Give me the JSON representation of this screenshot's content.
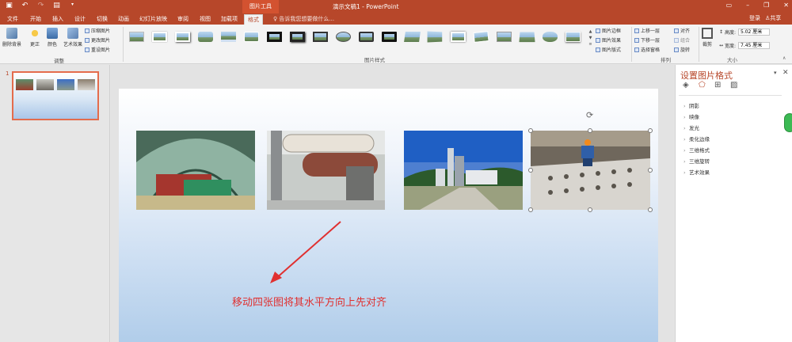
{
  "titlebar": {
    "context_tools": "图片工具",
    "doc_title": "演示文稿1 - PowerPoint"
  },
  "tabs": [
    {
      "label": "文件"
    },
    {
      "label": "开始"
    },
    {
      "label": "插入"
    },
    {
      "label": "设计"
    },
    {
      "label": "切换"
    },
    {
      "label": "动画"
    },
    {
      "label": "幻灯片放映"
    },
    {
      "label": "审阅"
    },
    {
      "label": "视图"
    },
    {
      "label": "加载项"
    },
    {
      "label": "格式"
    }
  ],
  "tell_me": "告诉我您想要做什么...",
  "account": {
    "login": "登录",
    "share": "共享"
  },
  "ribbon": {
    "adjust": {
      "remove_bg": "删除背景",
      "corrections": "更正",
      "color": "颜色",
      "artistic": "艺术效果",
      "compress": "压缩图片",
      "change": "更改图片",
      "reset": "重设图片",
      "group_label": "调整"
    },
    "styles": {
      "group_label": "图片样式",
      "border": "图片边框",
      "effects": "图片效果",
      "layout": "图片版式"
    },
    "arrange": {
      "forward": "上移一层",
      "backward": "下移一层",
      "selection": "选择窗格",
      "align": "对齐",
      "group": "组合",
      "rotate": "旋转",
      "group_label": "排列"
    },
    "size": {
      "crop": "裁剪",
      "height_label": "高度:",
      "height_value": "5.02 厘米",
      "width_label": "宽度:",
      "width_value": "7.45 厘米",
      "group_label": "大小"
    }
  },
  "slides_pane": {
    "slide_number": "1"
  },
  "slide": {
    "annotation": "移动四张图将其水平方向上先对齐"
  },
  "format_pane": {
    "title": "设置图片格式",
    "items": [
      {
        "label": "阴影"
      },
      {
        "label": "映像"
      },
      {
        "label": "发光"
      },
      {
        "label": "柔化边缘"
      },
      {
        "label": "三维格式"
      },
      {
        "label": "三维旋转"
      },
      {
        "label": "艺术效果"
      }
    ]
  },
  "colors": {
    "accent": "#b7472a",
    "annotation": "#e03030"
  }
}
